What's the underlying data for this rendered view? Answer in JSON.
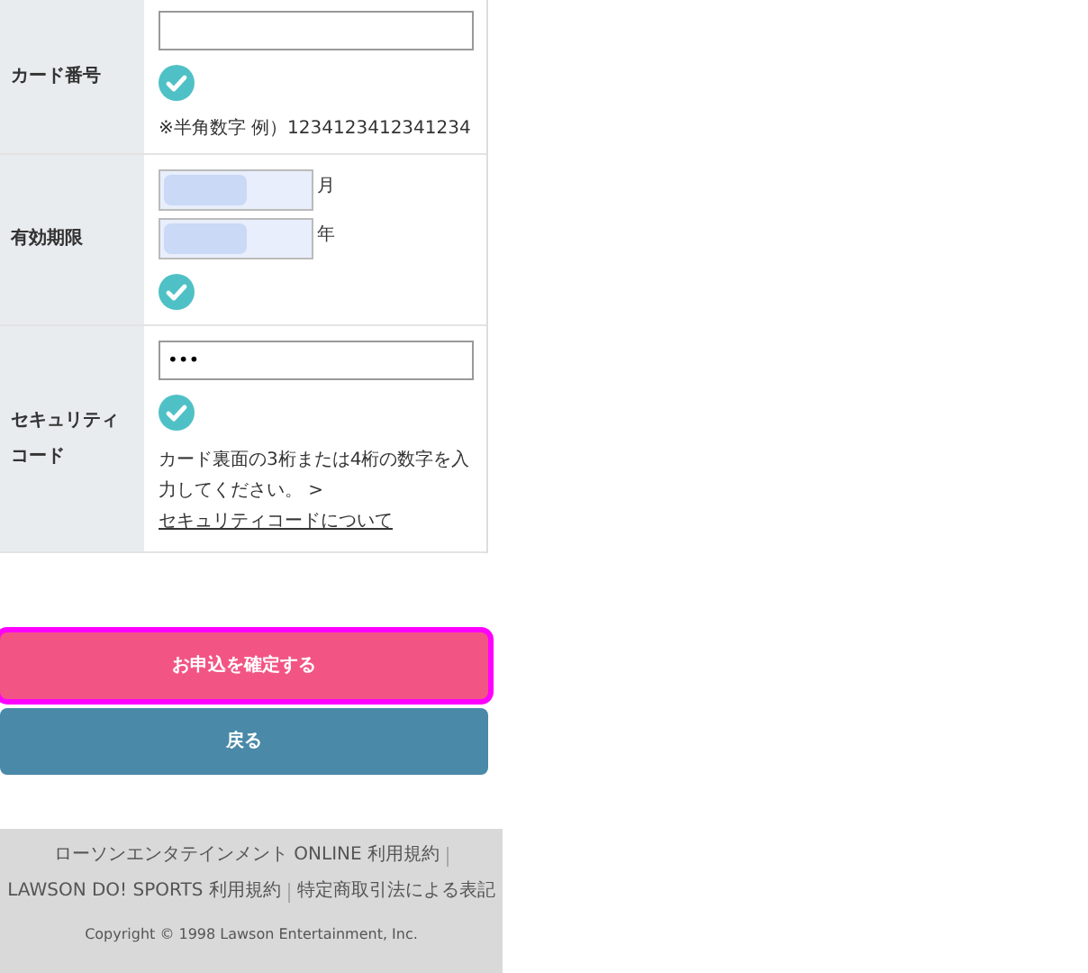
{
  "form": [
    {
      "kind": "card",
      "label": [
        "カード番号"
      ],
      "valid": true,
      "note": "※半角数字 例）1234123412341234"
    },
    {
      "kind": "expiry",
      "label": [
        "有効期限"
      ],
      "selects": [
        {
          "unit": "月"
        },
        {
          "unit": "年"
        }
      ],
      "valid": true
    },
    {
      "kind": "security",
      "label": [
        "セキュリティ",
        "コード"
      ],
      "value": "•••",
      "valid": true,
      "note": "カード裏面の3桁または4桁の数字を入力してください。 >",
      "link": "セキュリティコードについて"
    }
  ],
  "buttons": [
    {
      "kind": "primary",
      "label": "お申込を確定する",
      "focused": true
    },
    {
      "kind": "secondary",
      "label": "戻る",
      "focused": false
    }
  ],
  "footer": {
    "links": [
      "ローソンエンタテインメント ONLINE 利用規約",
      "LAWSON DO! SPORTS 利用規約",
      "特定商取引法による表記"
    ],
    "copyright": "Copyright © 1998 Lawson Entertainment, Inc."
  }
}
